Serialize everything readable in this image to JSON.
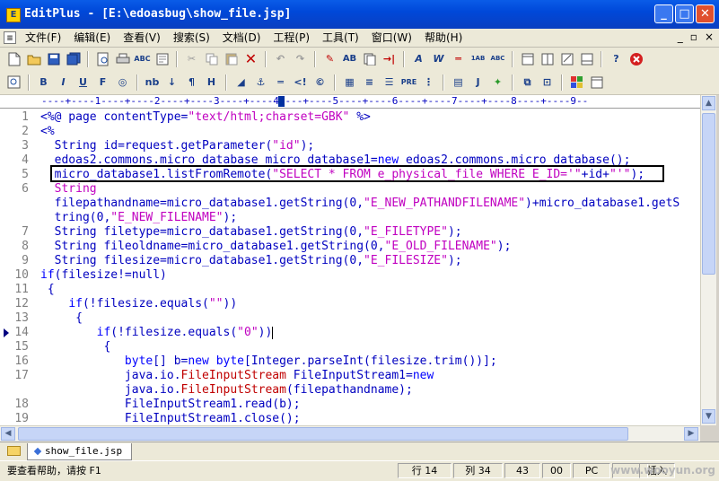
{
  "window": {
    "title": "EditPlus - [E:\\edoasbug\\show_file.jsp]",
    "controls": {
      "minimize": "_",
      "maximize": "□",
      "close": "✕"
    }
  },
  "menubar": {
    "items": [
      "文件(F)",
      "编辑(E)",
      "查看(V)",
      "搜索(S)",
      "文档(D)",
      "工程(P)",
      "工具(T)",
      "窗口(W)",
      "帮助(H)"
    ],
    "mdi_controls": [
      "_",
      "▫",
      "×"
    ]
  },
  "toolbar2_text": {
    "nb": "nb",
    "pre": "PRE",
    "j": "J",
    "h": "H"
  },
  "ruler": {
    "marks": "----+----1----+----2----+----3----+----4----+----5----+----6----+----7----+----8----+----9--"
  },
  "editor": {
    "lines": [
      {
        "n": "1",
        "segs": [
          [
            "t",
            "<%@ page contentType="
          ],
          [
            "s",
            "\"text/html;charset=GBK\""
          ],
          [
            "t",
            " %>"
          ]
        ]
      },
      {
        "n": "2",
        "segs": [
          [
            "t",
            "<%"
          ]
        ]
      },
      {
        "n": "3",
        "segs": [
          [
            "t",
            "  String id=request.getParameter("
          ],
          [
            "s",
            "\"id\""
          ],
          [
            "t",
            ");"
          ]
        ]
      },
      {
        "n": "4",
        "segs": [
          [
            "t",
            "  edoas2.commons.micro_database micro_database1="
          ],
          [
            "k",
            "new"
          ],
          [
            "t",
            " edoas2.commons.micro_database();"
          ]
        ]
      },
      {
        "n": "5",
        "segs": [
          [
            "t",
            "  micro_database1.listFromRemote("
          ],
          [
            "s",
            "\"SELECT * FROM e_physical_file WHERE E_ID='\""
          ],
          [
            "t",
            "+id+"
          ],
          [
            "s",
            "\"'\""
          ],
          [
            "t",
            ");"
          ]
        ]
      },
      {
        "n": "6",
        "segs": [
          [
            "s",
            "  String"
          ]
        ]
      },
      {
        "n": "",
        "segs": [
          [
            "t",
            "  filepathandname=micro_database1.getString(0,"
          ],
          [
            "s",
            "\"E_NEW_PATHANDFILENAME\""
          ],
          [
            "t",
            ")+micro_database1.getS"
          ]
        ]
      },
      {
        "n": "",
        "segs": [
          [
            "t",
            "  tring(0,"
          ],
          [
            "s",
            "\"E_NEW_FILENAME\""
          ],
          [
            "t",
            ");"
          ]
        ]
      },
      {
        "n": "7",
        "segs": [
          [
            "t",
            "  String filetype=micro_database1.getString(0,"
          ],
          [
            "s",
            "\"E_FILETYPE\""
          ],
          [
            "t",
            ");"
          ]
        ]
      },
      {
        "n": "8",
        "segs": [
          [
            "t",
            "  String fileoldname=micro_database1.getString(0,"
          ],
          [
            "s",
            "\"E_OLD_FILENAME\""
          ],
          [
            "t",
            ");"
          ]
        ]
      },
      {
        "n": "9",
        "segs": [
          [
            "t",
            "  String filesize=micro_database1.getString(0,"
          ],
          [
            "s",
            "\"E_FILESIZE\""
          ],
          [
            "t",
            ");"
          ]
        ]
      },
      {
        "n": "10",
        "segs": [
          [
            "k",
            "if"
          ],
          [
            "t",
            "(filesize!=null)"
          ]
        ]
      },
      {
        "n": "11",
        "segs": [
          [
            "t",
            " {"
          ]
        ]
      },
      {
        "n": "12",
        "segs": [
          [
            "t",
            "    "
          ],
          [
            "k",
            "if"
          ],
          [
            "t",
            "(!filesize.equals("
          ],
          [
            "s",
            "\"\""
          ],
          [
            "t",
            "))"
          ]
        ]
      },
      {
        "n": "13",
        "segs": [
          [
            "t",
            "     {"
          ]
        ]
      },
      {
        "n": "14",
        "segs": [
          [
            "t",
            "        "
          ],
          [
            "k",
            "if"
          ],
          [
            "t",
            "(!filesize.equals("
          ],
          [
            "s",
            "\"0\""
          ],
          [
            "t",
            "))"
          ]
        ],
        "current": true
      },
      {
        "n": "15",
        "segs": [
          [
            "t",
            "         {"
          ]
        ]
      },
      {
        "n": "16",
        "segs": [
          [
            "t",
            "            "
          ],
          [
            "k",
            "byte"
          ],
          [
            "t",
            "[] b="
          ],
          [
            "k",
            "new"
          ],
          [
            "t",
            " "
          ],
          [
            "k",
            "byte"
          ],
          [
            "t",
            "[Integer.parseInt(filesize.trim())];"
          ]
        ]
      },
      {
        "n": "17",
        "segs": [
          [
            "t",
            "            java.io."
          ],
          [
            "c",
            "FileInputStream"
          ],
          [
            "t",
            " FileInputStream1="
          ],
          [
            "k",
            "new"
          ]
        ]
      },
      {
        "n": "",
        "segs": [
          [
            "t",
            "            java.io."
          ],
          [
            "c",
            "FileInputStream"
          ],
          [
            "t",
            "(filepathandname);"
          ]
        ]
      },
      {
        "n": "18",
        "segs": [
          [
            "t",
            "            FileInputStream1.read(b);"
          ]
        ]
      },
      {
        "n": "19",
        "segs": [
          [
            "t",
            "            FileInputStream1.close();"
          ]
        ]
      }
    ]
  },
  "tabs": [
    {
      "label": "show_file.jsp"
    }
  ],
  "status": {
    "help": "要查看帮助，请按 F1",
    "row_label": "行 14",
    "col_label": "列 34",
    "num1": "43",
    "num2": "00",
    "mode": "PC",
    "ins": "插入",
    "watermark": "www.wooyun.org"
  },
  "colors": {
    "string": "#c000c0",
    "keyword": "#0000ff",
    "text": "#0000c0",
    "class": "#c00000"
  }
}
